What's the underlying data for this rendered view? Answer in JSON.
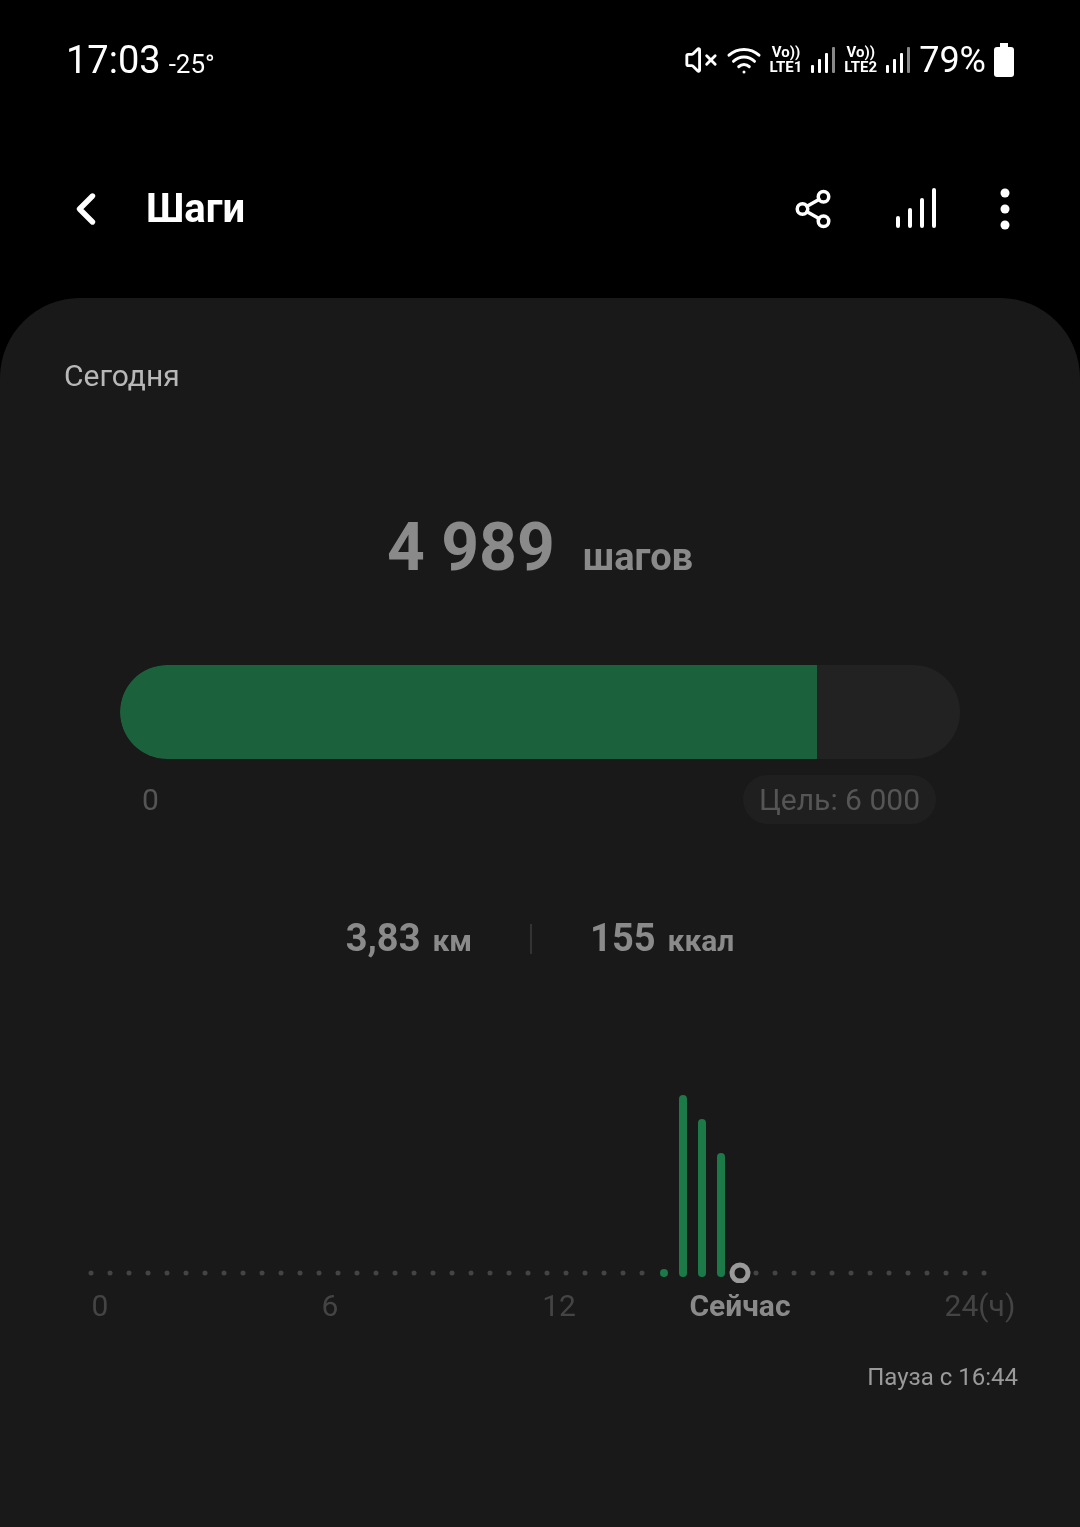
{
  "status_bar": {
    "time": "17:03",
    "temperature": "-25°",
    "sim1": {
      "volte": "Vo))",
      "network": "LTE1"
    },
    "sim2": {
      "volte": "Vo))",
      "network": "LTE2"
    },
    "battery": "79%"
  },
  "header": {
    "title": "Шаги"
  },
  "card": {
    "period": "Сегодня",
    "steps": "4 989",
    "steps_unit": "шагов",
    "progress": {
      "level": 0.83,
      "start": "0",
      "goal": "Цель: 6 000"
    },
    "distance": {
      "value": "3,83",
      "unit": "км"
    },
    "calories": {
      "value": "155",
      "unit": "ккал"
    },
    "timeline": {
      "labels": [
        {
          "text": "0",
          "kind": "tick"
        },
        {
          "text": "6",
          "kind": "tick"
        },
        {
          "text": "12",
          "kind": "tick"
        },
        {
          "text": "Сейчас",
          "kind": "now"
        },
        {
          "text": "24(ч)",
          "kind": "tick"
        }
      ]
    },
    "status": "Пауза с 16:44"
  }
}
